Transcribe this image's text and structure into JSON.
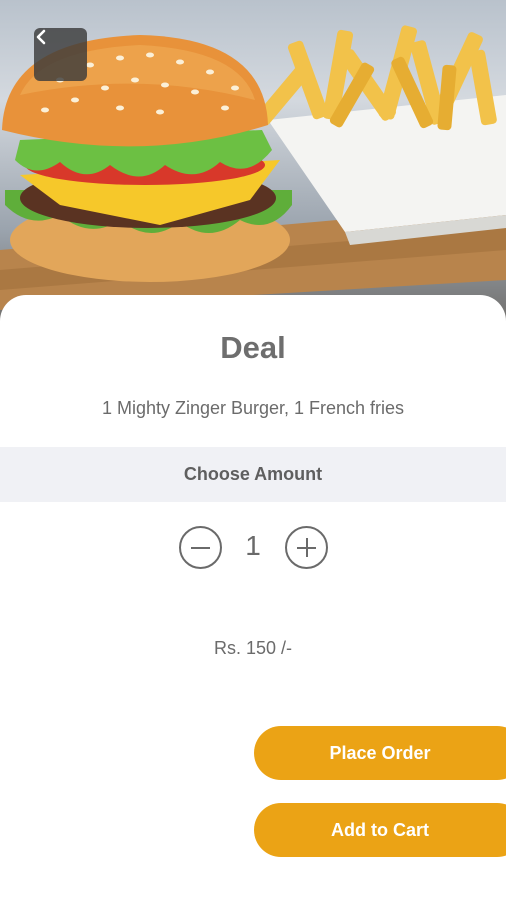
{
  "header": {
    "back_icon": "chevron-left-icon"
  },
  "hero": {
    "image_subject": "burger-and-fries-photo"
  },
  "deal": {
    "title": "Deal",
    "description": "1 Mighty Zinger Burger, 1 French fries"
  },
  "amount": {
    "label": "Choose Amount",
    "quantity": "1",
    "decrease_icon": "minus-circle-icon",
    "increase_icon": "plus-circle-icon"
  },
  "price": {
    "text": "Rs. 150 /-"
  },
  "actions": {
    "place_order": "Place Order",
    "add_to_cart": "Add to Cart"
  },
  "colors": {
    "accent": "#eba315",
    "text_gray": "#6e6e6e",
    "section_bg": "#f0f1f5"
  }
}
